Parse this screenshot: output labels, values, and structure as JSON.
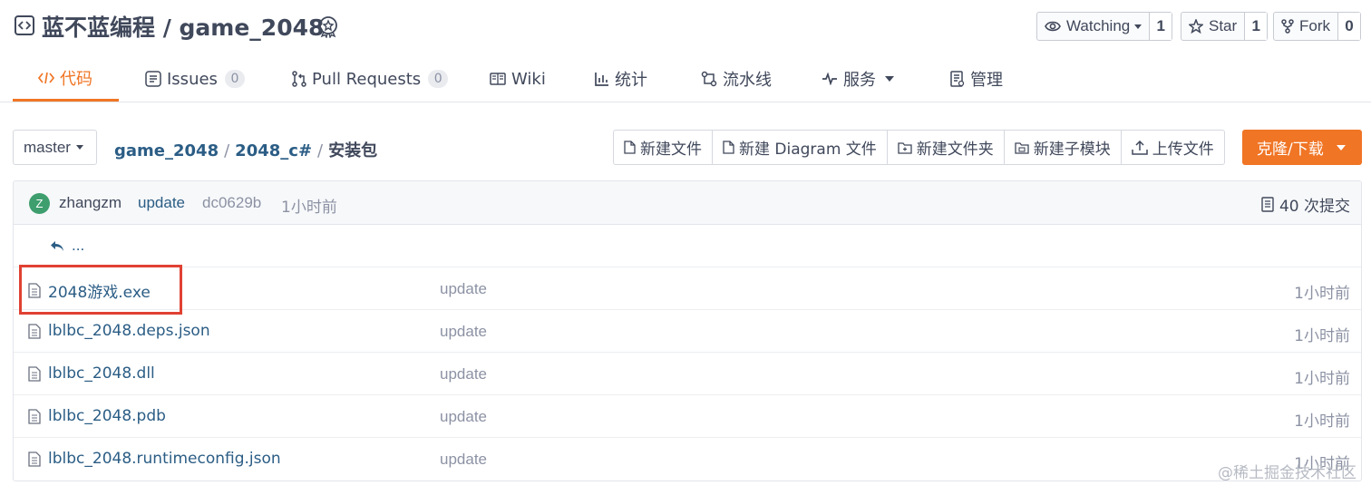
{
  "repo": {
    "title": "蓝不蓝编程 / game_2048"
  },
  "header_buttons": {
    "watching_label": "Watching",
    "watching_count": "1",
    "star_label": "Star",
    "star_count": "1",
    "fork_label": "Fork",
    "fork_count": "0"
  },
  "tabs": [
    {
      "label": "代码",
      "icon": "code-icon",
      "active": true
    },
    {
      "label": "Issues",
      "count": "0",
      "icon": "issues-icon"
    },
    {
      "label": "Pull Requests",
      "count": "0",
      "icon": "pull-request-icon"
    },
    {
      "label": "Wiki",
      "icon": "wiki-icon"
    },
    {
      "label": "统计",
      "icon": "stats-icon"
    },
    {
      "label": "流水线",
      "icon": "pipeline-icon"
    },
    {
      "label": "服务",
      "icon": "service-icon"
    },
    {
      "label": "管理",
      "icon": "manage-icon"
    }
  ],
  "toolbar": {
    "branch": "master",
    "breadcrumb": [
      "game_2048",
      "2048_c#",
      "安装包"
    ],
    "actions": [
      "新建文件",
      "新建 Diagram 文件",
      "新建文件夹",
      "新建子模块",
      "上传文件"
    ],
    "clone_label": "克隆/下载"
  },
  "commit": {
    "avatar_letter": "Z",
    "author": "zhangzm",
    "message": "update",
    "hash": "dc0629b",
    "time": "1小时前",
    "count_label": "40 次提交"
  },
  "parent_link": "...",
  "files": [
    {
      "name": "2048游戏.exe",
      "message": "update",
      "time": "1小时前"
    },
    {
      "name": "lblbc_2048.deps.json",
      "message": "update",
      "time": "1小时前"
    },
    {
      "name": "lblbc_2048.dll",
      "message": "update",
      "time": "1小时前"
    },
    {
      "name": "lblbc_2048.pdb",
      "message": "update",
      "time": "1小时前"
    },
    {
      "name": "lblbc_2048.runtimeconfig.json",
      "message": "update",
      "time": "1小时前"
    }
  ],
  "watermark": "@稀土掘金技术社区",
  "colors": {
    "accent": "#f07525",
    "link": "#2b5d85",
    "highlight": "#e04133"
  }
}
